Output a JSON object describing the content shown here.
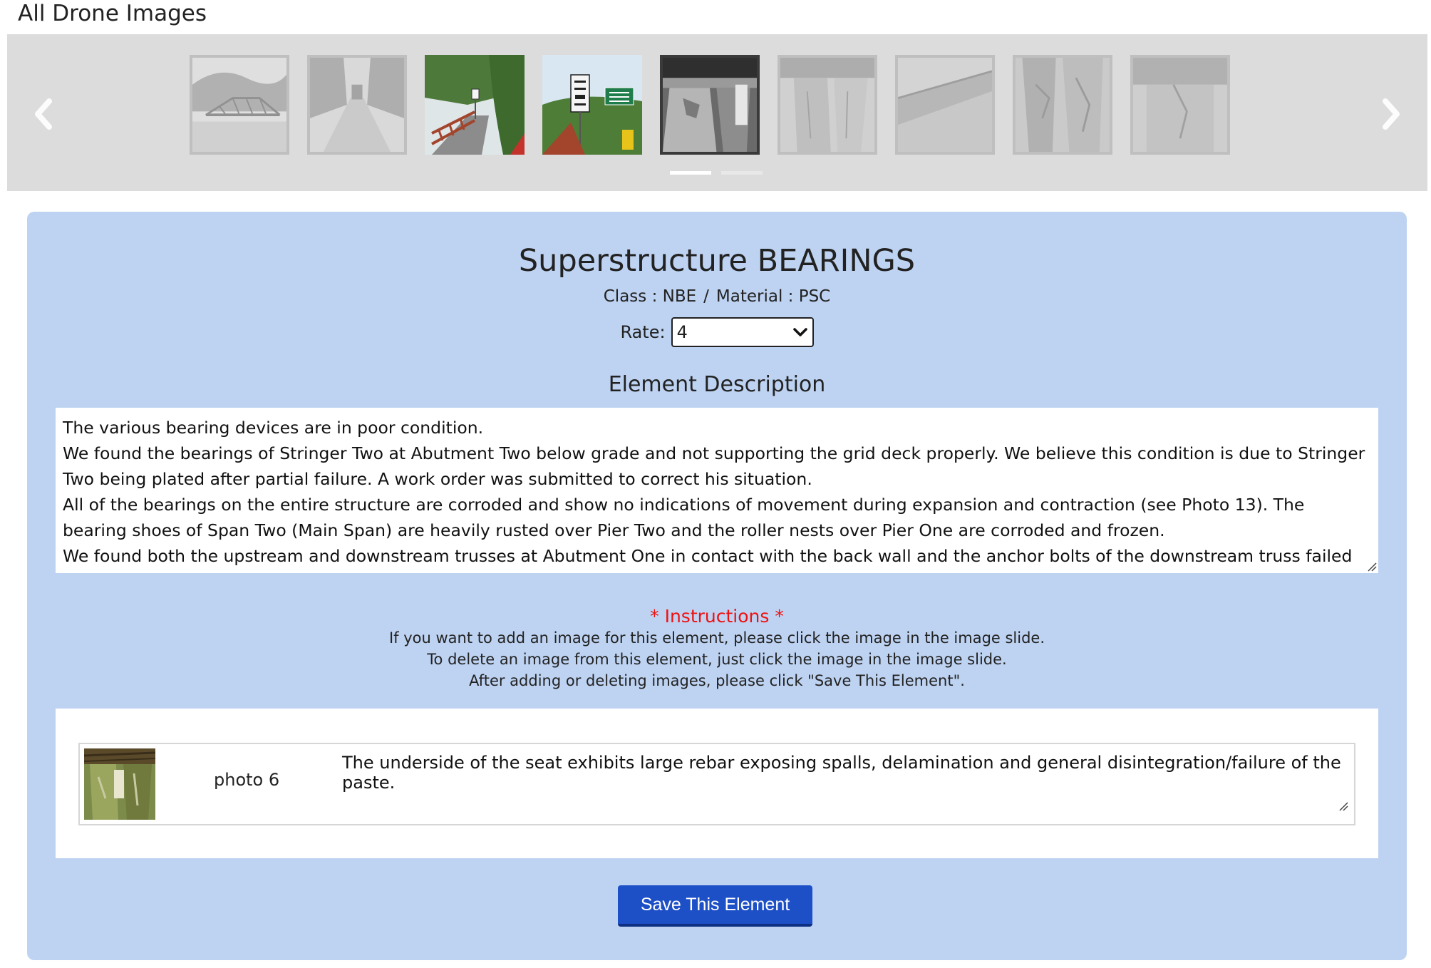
{
  "page": {
    "heading": "All Drone Images"
  },
  "carousel": {
    "thumbnails": [
      {
        "name": "bridge-truss-river",
        "state": "faded"
      },
      {
        "name": "bridge-road-approach",
        "state": "faded"
      },
      {
        "name": "bridge-red-truss",
        "state": "visible"
      },
      {
        "name": "weight-limit-sign",
        "state": "visible"
      },
      {
        "name": "bearing-closeup",
        "state": "active"
      },
      {
        "name": "concrete-seat",
        "state": "faded"
      },
      {
        "name": "underside-girder",
        "state": "faded"
      },
      {
        "name": "abutment-spall",
        "state": "faded"
      },
      {
        "name": "pier-cap",
        "state": "faded"
      }
    ],
    "indicators": [
      {
        "active": true
      },
      {
        "active": false
      }
    ]
  },
  "element": {
    "title": "Superstructure BEARINGS",
    "class_label": "Class : NBE",
    "separator": "/",
    "material_label": "Material : PSC",
    "rate_label": "Rate:",
    "rate_value": "4",
    "description_heading": "Element Description",
    "description_lines": [
      "The various bearing devices are in poor condition.",
      "We found the bearings of Stringer Two at Abutment Two below grade and not supporting the grid deck properly. We believe this condition is due to Stringer Two being plated after partial failure. A work order was submitted to correct his situation.",
      "All of the bearings on the entire structure are corroded and show no indications of movement during expansion and contraction (see Photo 13). The bearing shoes of Span Two (Main Span) are heavily rusted over Pier Two and the roller nests over Pier One are corroded and frozen.",
      "We found both the upstream and downstream trusses at Abutment One in contact with the back wall and the anchor bolts of the downstream truss failed at this location."
    ]
  },
  "instructions": {
    "title": "* Instructions *",
    "lines": [
      "If you want to add an image for this element, please click the image in the image slide.",
      "To delete an image from this element, just click the image in the image slide.",
      "After adding or deleting images, please click \"Save This Element\"."
    ]
  },
  "element_images": [
    {
      "name": "photo 6",
      "caption": "The underside of the seat exhibits large rebar exposing spalls, delamination and general disintegration/failure of the paste."
    }
  ],
  "actions": {
    "save_label": "Save This Element"
  },
  "colors": {
    "panel_bg": "#bed3f2",
    "carousel_bg": "#dcdcdc",
    "save_button": "#1d4fc7",
    "instructions_title": "#ee1111"
  }
}
